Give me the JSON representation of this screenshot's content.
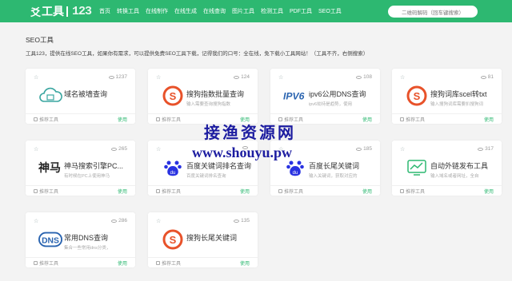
{
  "header": {
    "logo": {
      "mark": "爻",
      "text": "工具",
      "num": "123"
    },
    "nav": [
      "首页",
      "转换工具",
      "在线制作",
      "在线生成",
      "在线查询",
      "图片工具",
      "检测工具",
      "PDF工具",
      "SEO工具"
    ],
    "search_placeholder": "二维码解码（回车键搜索）"
  },
  "section": {
    "title": "SEO工具",
    "description": "工具123，提供在线SEO工具，如果你有需求，可以提供免费SEO工具下载，记得我们的口号：全在线，免下载小工具网站！（工具不齐，右侧搜索）"
  },
  "card_common": {
    "star": "☆",
    "recommend": "推荐工具",
    "use": "使用"
  },
  "cards": [
    {
      "name": "域名被墙查询",
      "views": "1237",
      "desc": "",
      "icon": "cloud-icon",
      "color": "#3aa6a0"
    },
    {
      "name": "搜狗指数批量查询",
      "views": "124",
      "desc": "输入需要查询搜狗指数",
      "icon": "sogou-icon",
      "color": "#e8522a"
    },
    {
      "name": "ipv6公用DNS查询",
      "views": "108",
      "desc": "ipv6劫持是趋势，使用",
      "icon": "ipv6-icon",
      "color": "#2a64b0"
    },
    {
      "name": "搜狗词库scel转txt",
      "views": "81",
      "desc": "输入搜狗词库需要扒搜狗词",
      "icon": "sogou-icon",
      "color": "#e8522a"
    },
    {
      "name": "神马搜索引擎PC...",
      "views": "265",
      "desc": "有时候在PC上使用神马",
      "icon": "shenma-icon",
      "color": "#222222"
    },
    {
      "name": "百度关键词排名查询",
      "views": "",
      "desc": "百度关键词排名查询",
      "icon": "baidu-icon",
      "color": "#2932e1"
    },
    {
      "name": "百度长尾关键词",
      "views": "185",
      "desc": "输入关键词，获取对应的",
      "icon": "baidu-icon",
      "color": "#2932e1"
    },
    {
      "name": "自动外链发布工具",
      "views": "317",
      "desc": "输入域名或者网址，全自",
      "icon": "chart-icon",
      "color": "#2db871"
    },
    {
      "name": "常用DNS查询",
      "views": "286",
      "desc": "集合一些常用dns分类，",
      "icon": "dns-icon",
      "color": "#2a64b0"
    },
    {
      "name": "搜狗长尾关键词",
      "views": "135",
      "desc": "",
      "icon": "sogou-icon",
      "color": "#e8522a"
    }
  ],
  "watermark": {
    "cn": "接渔资源网",
    "url": "www.shouyu.pw"
  }
}
